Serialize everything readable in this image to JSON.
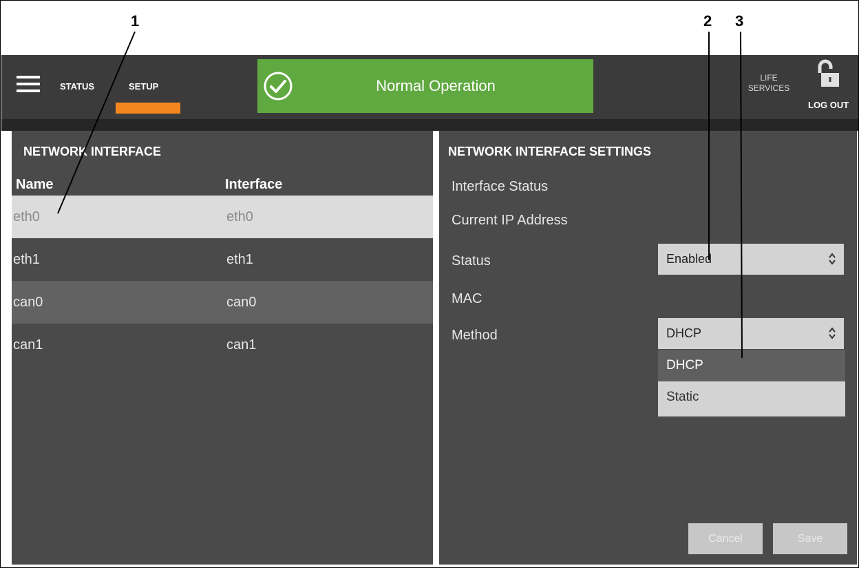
{
  "nav": {
    "status_label": "STATUS",
    "setup_label": "SETUP",
    "active_tab": "SETUP"
  },
  "banner": {
    "text": "Normal Operation",
    "color": "#60a940",
    "icon": "check-circle-icon"
  },
  "header_right": {
    "life_line1": "LIFE",
    "life_line2": "SERVICES",
    "logout_label": "LOG OUT",
    "lock_icon": "lock-open-icon"
  },
  "network_interface": {
    "title": "NETWORK INTERFACE",
    "columns": {
      "name": "Name",
      "interface": "Interface"
    },
    "rows": [
      {
        "name": "eth0",
        "interface": "eth0"
      },
      {
        "name": "eth1",
        "interface": "eth1"
      },
      {
        "name": "can0",
        "interface": "can0"
      },
      {
        "name": "can1",
        "interface": "can1"
      }
    ],
    "selected_row": "eth0"
  },
  "settings": {
    "title": "NETWORK INTERFACE SETTINGS",
    "labels": {
      "interface_status": "Interface Status",
      "current_ip": "Current IP Address",
      "status": "Status",
      "mac": "MAC",
      "method": "Method"
    },
    "status_value": "Enabled",
    "method_value": "DHCP",
    "method_options": [
      "DHCP",
      "Static"
    ],
    "cancel_label": "Cancel",
    "save_label": "Save"
  },
  "callouts": [
    "1",
    "2",
    "3"
  ],
  "colors": {
    "accent": "#f5861f",
    "topbar": "#3b3b3b",
    "panel": "#4a4a4a"
  }
}
